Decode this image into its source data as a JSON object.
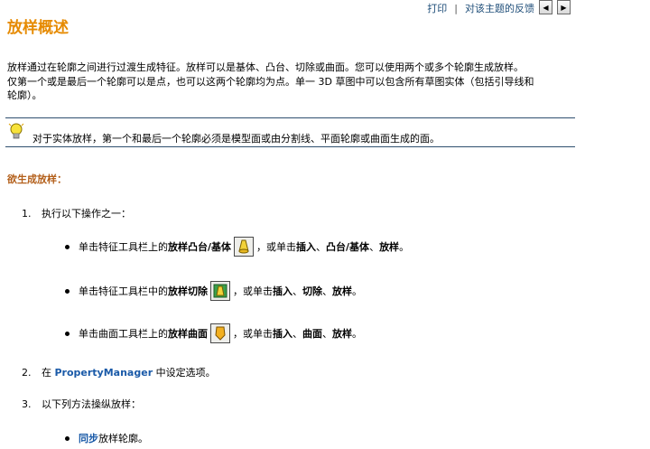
{
  "topbar": {
    "print_label": "打印",
    "separator": "|",
    "feedback_label": "对该主题的反馈",
    "back_arrow": "◀",
    "forward_arrow": "▶"
  },
  "page_title": "放样概述",
  "intro": {
    "line1": "放样通过在轮廓之间进行过渡生成特征。放样可以是基体、凸台、切除或曲面。您可以使用两个或多个轮廓生成放样。",
    "line2": "仅第一个或是最后一个轮廓可以是点，也可以这两个轮廓均为点。单一 3D 草图中可以包含所有草图实体（包括引导线和",
    "line3": "轮廓）。"
  },
  "note": {
    "text": "对于实体放样，第一个和最后一个轮廓必须是模型面或由分割线、平面轮廓或曲面生成的面。",
    "icon": "lightbulb-icon"
  },
  "section_heading": "欲生成放样：",
  "steps": [
    {
      "num": "1.",
      "text": "执行以下操作之一："
    },
    {
      "num": "2.",
      "pre": "在 ",
      "link": "PropertyManager",
      "post": " 中设定选项。"
    },
    {
      "num": "3.",
      "text": "以下列方法操纵放样："
    }
  ],
  "bullets": [
    {
      "pre": "单击特征工具栏上的",
      "bold": "放样凸台/基体",
      "icon": "loft-boss-icon",
      "post1": "，或单击",
      "m1": "插入",
      "s1": "、",
      "m2": "凸台/基体",
      "s2": "、",
      "m3": "放样",
      "end": "。"
    },
    {
      "pre": "单击特征工具栏中的",
      "bold": "放样切除",
      "icon": "loft-cut-icon",
      "post1": "，或单击",
      "m1": "插入",
      "s1": "、",
      "m2": "切除",
      "s2": "、",
      "m3": "放样",
      "end": "。"
    },
    {
      "pre": "单击曲面工具栏上的",
      "bold": "放样曲面",
      "icon": "loft-surface-icon",
      "post1": "，或单击",
      "m1": "插入",
      "s1": "、",
      "m2": "曲面",
      "s2": "、",
      "m3": "放样",
      "end": "。"
    }
  ],
  "bullet4": {
    "link": "同步",
    "text": "放样轮廓。"
  },
  "colors": {
    "title": "#e68a00",
    "section": "#b35f1a",
    "link": "#1a5aa8",
    "rule": "#2f4f6f"
  }
}
